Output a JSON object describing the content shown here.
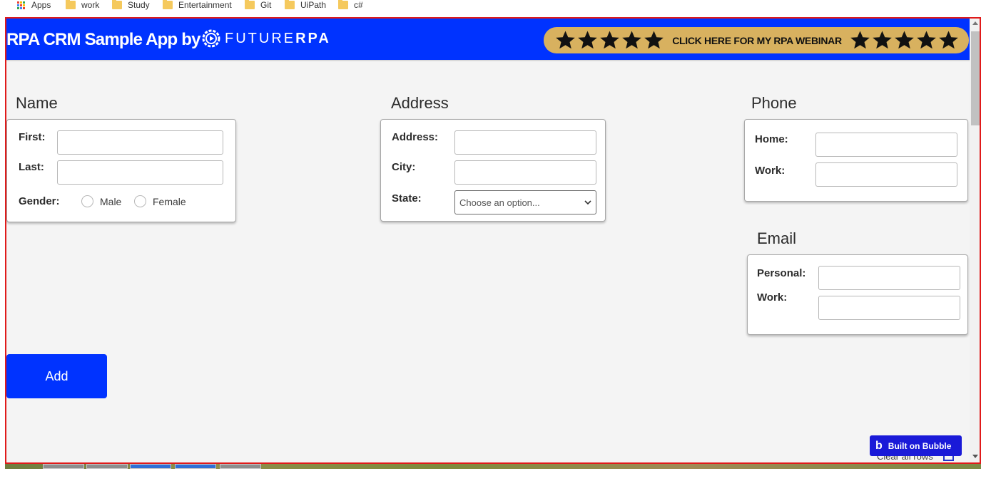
{
  "bookmarks": [
    {
      "label": "Apps",
      "icon": "apps-grid-icon"
    },
    {
      "label": "work",
      "icon": "folder-icon"
    },
    {
      "label": "Study",
      "icon": "folder-icon"
    },
    {
      "label": "Entertainment",
      "icon": "folder-icon"
    },
    {
      "label": "Git",
      "icon": "folder-icon"
    },
    {
      "label": "UiPath",
      "icon": "folder-icon"
    },
    {
      "label": "c#",
      "icon": "folder-icon"
    }
  ],
  "header": {
    "title": "RPA CRM Sample App by",
    "logo_light": "FUTURE",
    "logo_bold": "RPA",
    "webinar_label": "CLICK HERE FOR MY RPA WEBINAR",
    "star_count_each_side": 5
  },
  "name_section": {
    "heading": "Name",
    "first_label": "First:",
    "first_value": "",
    "last_label": "Last:",
    "last_value": "",
    "gender_label": "Gender:",
    "gender_options": [
      "Male",
      "Female"
    ],
    "gender_selected": null
  },
  "address_section": {
    "heading": "Address",
    "address_label": "Address:",
    "address_value": "",
    "city_label": "City:",
    "city_value": "",
    "state_label": "State:",
    "state_selected": "Choose an option..."
  },
  "phone_section": {
    "heading": "Phone",
    "home_label": "Home:",
    "home_value": "",
    "work_label": "Work:",
    "work_value": ""
  },
  "email_section": {
    "heading": "Email",
    "personal_label": "Personal:",
    "personal_value": "",
    "work_label": "Work:",
    "work_value": ""
  },
  "actions": {
    "add_label": "Add"
  },
  "footer": {
    "badge_label": "Built on Bubble",
    "badge_glyph": "b",
    "clear_rows_label": "Clear all rows"
  },
  "colors": {
    "brand_blue": "#0033ff",
    "webinar_gold": "#d8b15f",
    "frame_red": "#e01a1a",
    "page_bg": "#f4f4f4"
  }
}
